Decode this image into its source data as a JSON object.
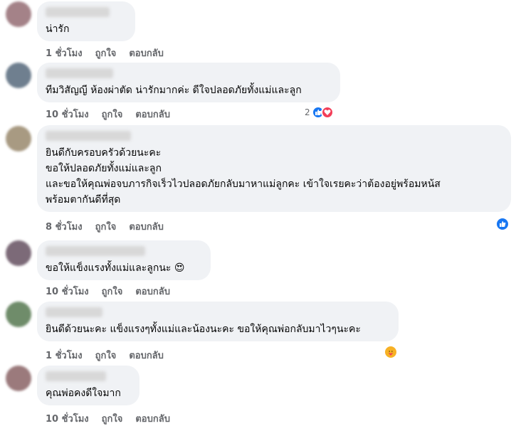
{
  "comments": [
    {
      "text": "น่ารัก",
      "time": "1 ชั่วโมง",
      "like": "ถูกใจ",
      "reply": "ตอบกลับ"
    },
    {
      "text": "ทีมวิสัญญี ห้องผ่าตัด น่ารักมากค่ะ ดีใจปลอดภัยทั้งแม่และลูก",
      "time": "10 ชั่วโมง",
      "like": "ถูกใจ",
      "reply": "ตอบกลับ",
      "reaction_count": "2",
      "reactions": [
        "like-icon",
        "love-icon"
      ]
    },
    {
      "text": "ยินดีกับครอบครัวด้วยนะคะ\nขอให้ปลอดภัยทั้งแม่และลูก\nและขอให้คุณพ่อจบภารกิจเร็วไวปลอดภัยกลับมาหาแม่ลูกคะ เข้าใจเรยคะว่าต้องอยู่พร้อมหน้ส\nพร้อมตากันดีที่สุด",
      "time": "8 ชั่วโมง",
      "like": "ถูกใจ",
      "reply": "ตอบกลับ",
      "reactions": [
        "like-icon"
      ]
    },
    {
      "text": "ขอให้แข็งแรงทั้งแม่และลูกนะ 😍",
      "time": "10 ชั่วโมง",
      "like": "ถูกใจ",
      "reply": "ตอบกลับ"
    },
    {
      "text": "ยินดีด้วยนะคะ แข็งแรงๆทั้งแม่และน้องนะคะ ขอให้คุณพ่อกลับมาไวๆนะคะ",
      "time": "1 ชั่วโมง",
      "like": "ถูกใจ",
      "reply": "ตอบกลับ",
      "reactions": [
        "care-icon"
      ]
    },
    {
      "text": "คุณพ่อคงดีใจมาก",
      "time": "10 ชั่วโมง",
      "like": "ถูกใจ",
      "reply": "ตอบกลับ"
    }
  ],
  "colors": {
    "bubble": "#f0f2f5",
    "meta": "#65676b",
    "like": "#1877f2",
    "love": "#f33e58",
    "care": "#f7b125"
  }
}
